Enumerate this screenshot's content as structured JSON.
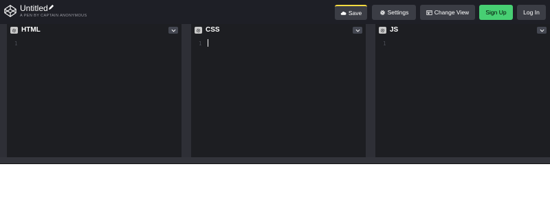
{
  "app": {
    "title": "Untitled",
    "byline": "A PEN BY CAPTAIN ANONYMOUS"
  },
  "toolbar": {
    "save_label": "Save",
    "settings_label": "Settings",
    "change_view_label": "Change View",
    "signup_label": "Sign Up",
    "login_label": "Log In"
  },
  "editors": [
    {
      "title": "HTML",
      "line_number": "1"
    },
    {
      "title": "CSS",
      "line_number": "1"
    },
    {
      "title": "JS",
      "line_number": "1"
    }
  ],
  "colors": {
    "header_bg": "#1e1f26",
    "editor_bg": "#1d1e22",
    "button_bg": "#3b3d45",
    "signup_green": "#47cf73",
    "save_accent": "#ffdd40"
  },
  "icons": {
    "logo": "codepen-logo-icon",
    "title_edit": "pencil-icon",
    "save": "cloud-icon",
    "settings": "gear-icon",
    "change_view": "layout-icon",
    "pane_settings": "gear-icon",
    "pane_collapse": "chevron-down-icon"
  }
}
